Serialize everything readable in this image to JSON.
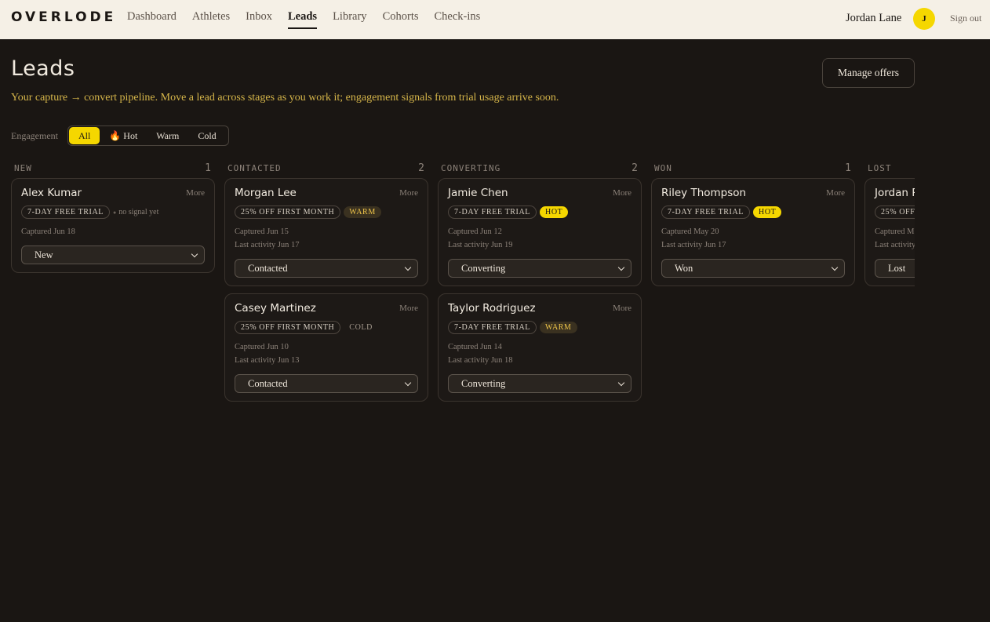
{
  "header": {
    "brand": "OVERLODE",
    "nav": [
      "Dashboard",
      "Athletes",
      "Inbox",
      "Leads",
      "Library",
      "Cohorts",
      "Check-ins"
    ],
    "active_nav": "Leads",
    "user_name": "Jordan Lane",
    "avatar_initial": "J",
    "sign_out": "Sign out"
  },
  "page": {
    "title": "Leads",
    "subtitle": "Your capture → convert pipeline. Move a lead across stages as you work it; engagement signals from trial usage arrive soon.",
    "manage_offers": "Manage offers"
  },
  "filter": {
    "label": "Engagement",
    "options": [
      "All",
      "🔥 Hot",
      "Warm",
      "Cold"
    ],
    "active": "All"
  },
  "columns": [
    {
      "label": "NEW",
      "count": "1",
      "cards": [
        {
          "name": "Alex Kumar",
          "more": "More",
          "offer": "7-DAY FREE TRIAL",
          "engagement": "no signal yet",
          "captured": "Captured Jun 18",
          "activity": "",
          "stage": "New"
        }
      ]
    },
    {
      "label": "CONTACTED",
      "count": "2",
      "cards": [
        {
          "name": "Morgan Lee",
          "more": "More",
          "offer": "25% OFF FIRST MONTH",
          "engagement": "WARM",
          "captured": "Captured Jun 15",
          "activity": "Last activity Jun 17",
          "stage": "Contacted"
        },
        {
          "name": "Casey Martinez",
          "more": "More",
          "offer": "25% OFF FIRST MONTH",
          "engagement": "COLD",
          "captured": "Captured Jun 10",
          "activity": "Last activity Jun 13",
          "stage": "Contacted"
        }
      ]
    },
    {
      "label": "CONVERTING",
      "count": "2",
      "cards": [
        {
          "name": "Jamie Chen",
          "more": "More",
          "offer": "7-DAY FREE TRIAL",
          "engagement": "HOT",
          "captured": "Captured Jun 12",
          "activity": "Last activity Jun 19",
          "stage": "Converting"
        },
        {
          "name": "Taylor Rodriguez",
          "more": "More",
          "offer": "7-DAY FREE TRIAL",
          "engagement": "WARM",
          "captured": "Captured Jun 14",
          "activity": "Last activity Jun 18",
          "stage": "Converting"
        }
      ]
    },
    {
      "label": "WON",
      "count": "1",
      "cards": [
        {
          "name": "Riley Thompson",
          "more": "More",
          "offer": "7-DAY FREE TRIAL",
          "engagement": "HOT",
          "captured": "Captured May 20",
          "activity": "Last activity Jun 17",
          "stage": "Won"
        }
      ]
    },
    {
      "label": "LOST",
      "count": "",
      "cards": [
        {
          "name": "Jordan R",
          "more": "",
          "offer": "25% OFF",
          "engagement": "",
          "captured": "Captured M",
          "activity": "Last activity",
          "stage": "Lost"
        }
      ]
    }
  ]
}
